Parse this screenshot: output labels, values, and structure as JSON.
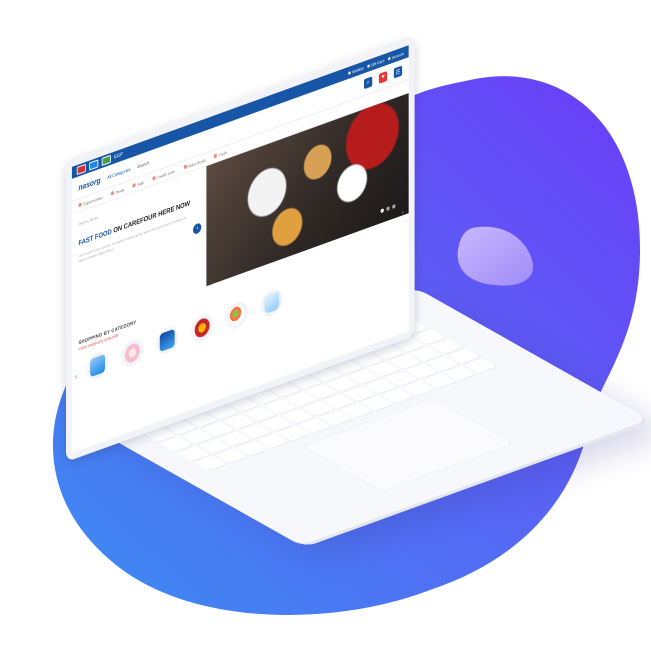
{
  "colors": {
    "blob_start": "#3b8cf2",
    "blob_end": "#6a3cf8",
    "brand_blue": "#1756a6",
    "accent_red": "#e53935"
  },
  "site": {
    "topbar": {
      "currency": "EGP",
      "items": [
        "Wishlist",
        "Gift Card",
        "Account"
      ]
    },
    "header": {
      "logo": "nasorg",
      "nav": [
        "All Categories",
        "Search"
      ],
      "icons": [
        "search-icon",
        "cart-icon",
        "user-icon"
      ]
    },
    "subnav": [
      "Supermarket",
      "Deals",
      "Sale",
      "Health Care",
      "Baby World",
      "Fresh"
    ],
    "hero": {
      "small": "Grocery Stores",
      "title_accent": "FAST FOOD",
      "title_rest": "ON CAREFOUR HERE NOW",
      "desc": "Lorem ipsum dolor sit amet, consectetur adipiscing elit, sed do eiusmod tempor incididunt ut labore et dolore magna aliqua.",
      "go": "›"
    },
    "category": {
      "title": "SHOPPING BY CATEGORY",
      "subtitle": "online shopping by using body",
      "prev": "‹",
      "next": "›"
    }
  }
}
